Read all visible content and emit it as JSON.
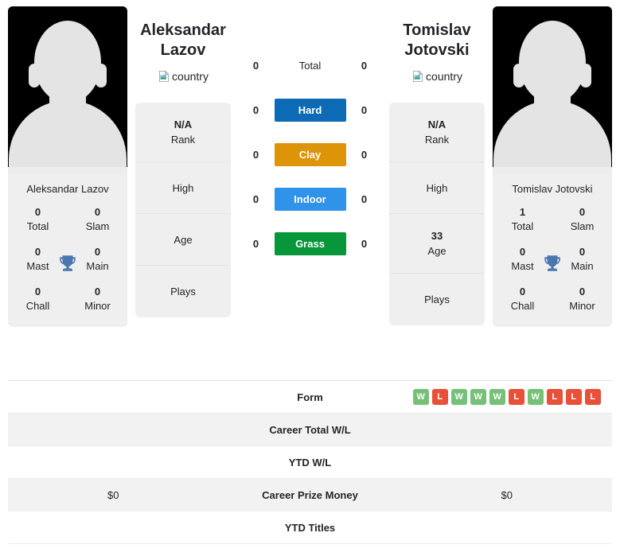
{
  "players": {
    "left": {
      "name": "Aleksandar Lazov",
      "name_display": "Aleksandar\nLazov",
      "first_name": "Aleksandar",
      "last_name": "Lazov",
      "country_alt": "country",
      "avatar_alt": "Aleksandar Lazov",
      "info": [
        {
          "value": "N/A",
          "label": "Rank"
        },
        {
          "value": "",
          "label": "High"
        },
        {
          "value": "",
          "label": "Age"
        },
        {
          "value": "",
          "label": "Plays"
        }
      ],
      "titles": [
        {
          "value": "0",
          "label": "Total"
        },
        {
          "value": "0",
          "label": "Slam"
        },
        {
          "value": "0",
          "label": "Mast"
        },
        {
          "value": "0",
          "label": "Main"
        },
        {
          "value": "0",
          "label": "Chall"
        },
        {
          "value": "0",
          "label": "Minor"
        }
      ]
    },
    "right": {
      "name": "Tomislav Jotovski",
      "name_display": "Tomislav\nJotovski",
      "first_name": "Tomislav",
      "last_name": "Jotovski",
      "country_alt": "country",
      "avatar_alt": "Tomislav Jotovski",
      "info": [
        {
          "value": "N/A",
          "label": "Rank"
        },
        {
          "value": "",
          "label": "High"
        },
        {
          "value": "33",
          "label": "Age"
        },
        {
          "value": "",
          "label": "Plays"
        }
      ],
      "titles": [
        {
          "value": "1",
          "label": "Total"
        },
        {
          "value": "0",
          "label": "Slam"
        },
        {
          "value": "0",
          "label": "Mast"
        },
        {
          "value": "0",
          "label": "Main"
        },
        {
          "value": "0",
          "label": "Chall"
        },
        {
          "value": "0",
          "label": "Minor"
        }
      ]
    }
  },
  "surfaces": [
    {
      "label": "Total",
      "left": "0",
      "right": "0",
      "color": "transparent",
      "plain": true
    },
    {
      "label": "Hard",
      "left": "0",
      "right": "0",
      "color": "#0d6bb5",
      "plain": false
    },
    {
      "label": "Clay",
      "left": "0",
      "right": "0",
      "color": "#de9409",
      "plain": false
    },
    {
      "label": "Indoor",
      "left": "0",
      "right": "0",
      "color": "#2f93ea",
      "plain": false
    },
    {
      "label": "Grass",
      "left": "0",
      "right": "0",
      "color": "#079639",
      "plain": false
    }
  ],
  "comparison_rows": [
    {
      "label": "Form",
      "left": "",
      "right": "",
      "type": "form"
    },
    {
      "label": "Career Total W/L",
      "left": "",
      "right": "",
      "type": "text"
    },
    {
      "label": "YTD W/L",
      "left": "",
      "right": "",
      "type": "text"
    },
    {
      "label": "Career Prize Money",
      "left": "$0",
      "right": "$0",
      "type": "text"
    },
    {
      "label": "YTD Titles",
      "left": "",
      "right": "",
      "type": "text"
    }
  ],
  "form": {
    "left": [],
    "right": [
      "W",
      "L",
      "W",
      "W",
      "W",
      "L",
      "W",
      "L",
      "L",
      "L"
    ]
  },
  "colors": {
    "hard": "#0d6bb5",
    "clay": "#de9409",
    "indoor": "#2f93ea",
    "grass": "#079639",
    "win": "#77c078",
    "loss": "#e8503a",
    "trophy": "#4a77b0",
    "card_bg": "#efefef",
    "row_alt_bg": "#f2f2f2"
  }
}
